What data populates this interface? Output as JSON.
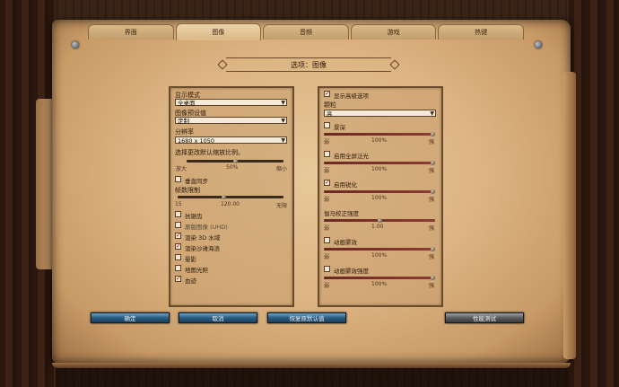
{
  "tabs": [
    "界面",
    "图像",
    "音频",
    "游戏",
    "热键"
  ],
  "active_tab": 1,
  "title": "选项：图像",
  "left": {
    "display_mode_label": "显示模式",
    "display_mode_value": "全桌面",
    "preset_label": "图像预设值",
    "preset_value": "定制",
    "resolution_label": "分辨率",
    "resolution_value": "1680 x 1050",
    "scale_note": "选择更改默认缩放比例。",
    "scale_min": "放大",
    "scale_value": "50%",
    "scale_max": "缩小",
    "scale_fraction": 0.5,
    "vsync_label": "垂直同步",
    "fps_label": "帧数限制",
    "fps_min": "15",
    "fps_value": "120.00",
    "fps_max": "无限",
    "fps_fraction": 0.43,
    "checkboxes": [
      {
        "label": "抗锯齿",
        "checked": false,
        "dim": false
      },
      {
        "label": "原版图像 (UHD)",
        "checked": false,
        "dim": true
      },
      {
        "label": "渲染 3D 水域",
        "checked": true,
        "dim": false
      },
      {
        "label": "渲染沙滩海浪",
        "checked": true,
        "dim": false
      },
      {
        "label": "晕影",
        "checked": false,
        "dim": false
      },
      {
        "label": "地图光照",
        "checked": false,
        "dim": false
      },
      {
        "label": "血迹",
        "checked": true,
        "dim": false
      }
    ]
  },
  "right": {
    "show_advanced_label": "显示高级选项",
    "particles_label": "颗粒",
    "particles_value": "高",
    "sliders": [
      {
        "label": "景深",
        "checked": false,
        "min": "弱",
        "value": "100%",
        "max": "强",
        "fraction": 1.0
      },
      {
        "label": "启用全屏泛光",
        "checked": false,
        "min": "弱",
        "value": "100%",
        "max": "强",
        "fraction": 1.0
      },
      {
        "label": "启用锐化",
        "checked": true,
        "min": "弱",
        "value": "100%",
        "max": "强",
        "fraction": 1.0
      },
      {
        "label": "伽马校正强度",
        "checked": null,
        "min": "弱",
        "value": "1.00",
        "max": "强",
        "fraction": 0.5
      },
      {
        "label": "动画雾效",
        "checked": false,
        "min": "弱",
        "value": "100%",
        "max": "强",
        "fraction": 1.0
      },
      {
        "label": "动画雾效强度",
        "checked": false,
        "min": "弱",
        "value": "100%",
        "max": "强",
        "fraction": 1.0
      }
    ]
  },
  "buttons": {
    "ok": "确定",
    "cancel": "取消",
    "defaults": "恢复原默认值",
    "benchmark": "性能测试"
  },
  "colors": {
    "checkmark": "#b01818",
    "button_blue": "#2a5c80",
    "parchment": "#ddb583"
  }
}
